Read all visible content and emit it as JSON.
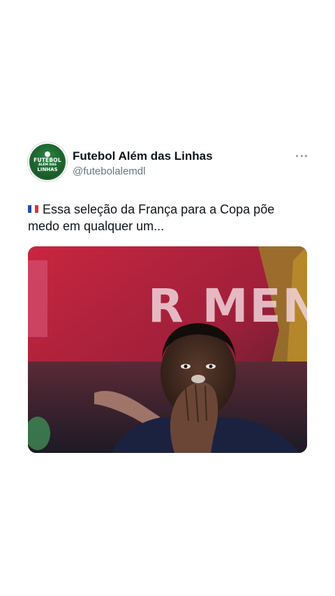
{
  "tweet": {
    "display_name": "Futebol Além das Linhas",
    "handle": "@futebolalemdl",
    "text": "Essa seleção da França para a Copa põe medo em qualquer um...",
    "flag_icon": "france-flag-icon",
    "more_icon": "more-icon"
  },
  "avatar": {
    "line1": "FUTEBOL",
    "line2": "ALÉM DAS",
    "line3": "LINHAS"
  },
  "media": {
    "banner_text": "R MEN",
    "description_icon": "video-thumbnail"
  },
  "colors": {
    "brand_green": "#1f6a33",
    "text": "#0f1419",
    "secondary_text": "#657786",
    "flag_blue": "#1f4fa0",
    "flag_white": "#ffffff",
    "flag_red": "#e0313a"
  }
}
